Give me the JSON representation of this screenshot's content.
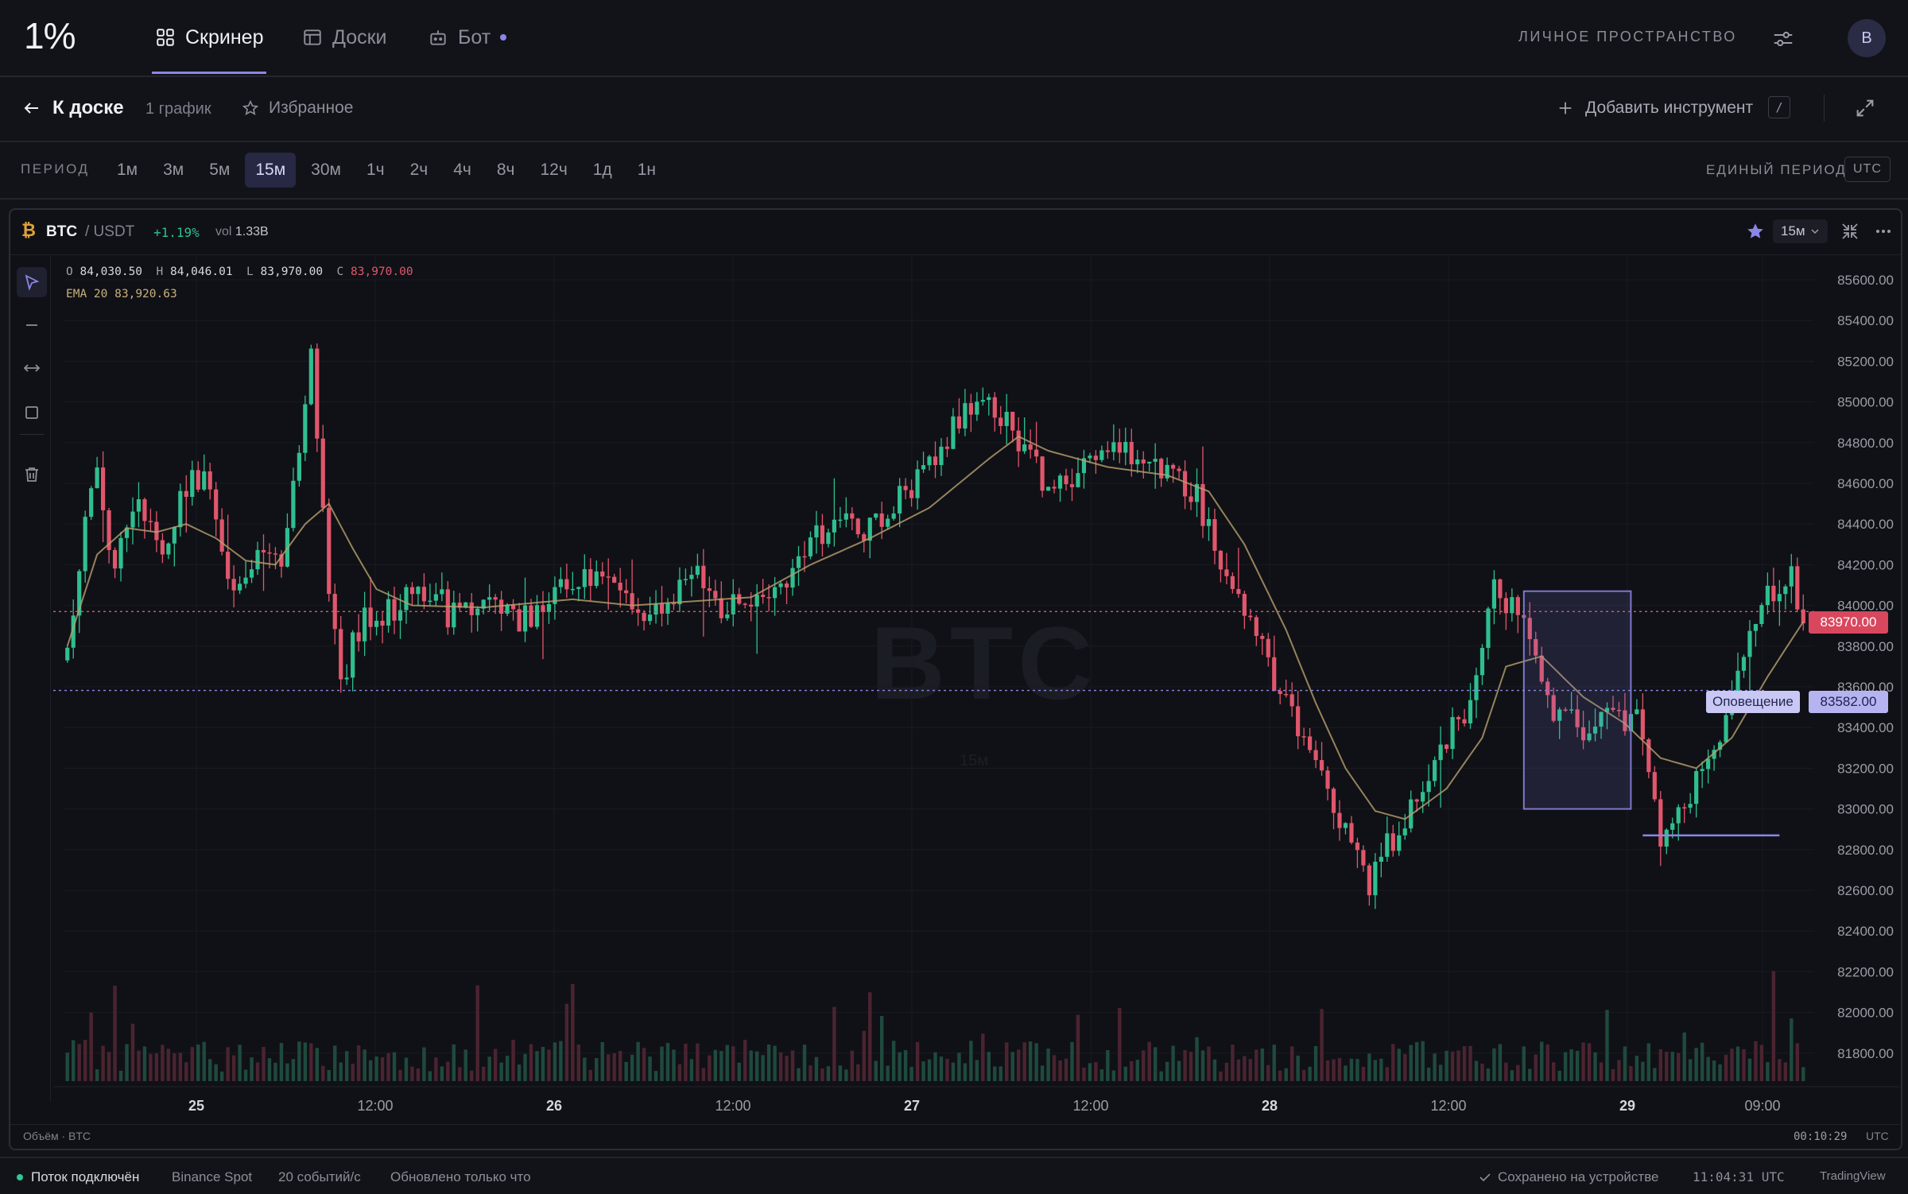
{
  "app": {
    "logo": "1%",
    "nav": [
      {
        "label": "Скринер",
        "icon": "grid-icon",
        "active": true
      },
      {
        "label": "Доски",
        "icon": "board-icon"
      },
      {
        "label": "Бот",
        "icon": "bot-icon"
      }
    ],
    "workspace_label": "ЛИЧНОЕ ПРОСТРАНСТВО",
    "avatar_initial": "B",
    "accent": "#8b86e6"
  },
  "subbar": {
    "back_label": "К доске",
    "chart_count": "1 график",
    "favorites_label": "Избранное",
    "add_instrument_label": "Добавить инструмент",
    "shortcut_key": "/"
  },
  "periods": {
    "label": "ПЕРИОД",
    "items": [
      "1м",
      "3м",
      "5м",
      "15м",
      "30м",
      "1ч",
      "2ч",
      "4ч",
      "8ч",
      "12ч",
      "1д",
      "1н"
    ],
    "active": "15м",
    "unified_label": "ЕДИНЫЙ ПЕРИОД",
    "timezone": "UTC"
  },
  "chart_panel": {
    "symbol": "BTC",
    "quote": "/ USDT",
    "change": "+1.19%",
    "vol_label": "vol",
    "vol_value": "1.33B",
    "timeframe": "15м",
    "ohlc": {
      "o_label": "O",
      "o": "84,030.50",
      "h_label": "H",
      "h": "84,046.01",
      "l_label": "L",
      "l": "83,970.00",
      "c_label": "C",
      "c": "83,970.00"
    },
    "ema_label": "EMA 20",
    "ema_value": "83,920.63",
    "watermark": "BTC",
    "watermark_sub": "15м",
    "last_price": "83970.00",
    "alert_label": "Оповещение",
    "alert_price": "83582.00",
    "volume_label": "Объём · BTC",
    "timer": "00:10:29",
    "timezone": "UTC",
    "colors": {
      "up": "#2fbf8f",
      "down": "#e0566c",
      "ema": "#b8a06e",
      "alert": "#8b86e6"
    }
  },
  "chart_data": {
    "type": "candlestick",
    "y_ticks": [
      "85600.00",
      "85400.00",
      "85200.00",
      "85000.00",
      "84800.00",
      "84600.00",
      "84400.00",
      "84200.00",
      "84000.00",
      "83800.00",
      "83600.00",
      "83400.00",
      "83200.00",
      "83000.00",
      "82800.00",
      "82600.00",
      "82400.00",
      "82200.00",
      "82000.00",
      "81800.00"
    ],
    "x_ticks": [
      {
        "label": "25",
        "bold": true
      },
      {
        "label": "12:00"
      },
      {
        "label": "26",
        "bold": true
      },
      {
        "label": "12:00"
      },
      {
        "label": "27",
        "bold": true
      },
      {
        "label": "12:00"
      },
      {
        "label": "28",
        "bold": true
      },
      {
        "label": "12:00"
      },
      {
        "label": "29",
        "bold": true
      },
      {
        "label": "09:00"
      }
    ],
    "ylim": [
      81700,
      85700
    ],
    "price_path": [
      [
        0,
        83730
      ],
      [
        3,
        84470
      ],
      [
        5,
        84700
      ],
      [
        8,
        84170
      ],
      [
        12,
        84500
      ],
      [
        16,
        84200
      ],
      [
        20,
        84580
      ],
      [
        24,
        84650
      ],
      [
        28,
        84030
      ],
      [
        32,
        84320
      ],
      [
        36,
        84250
      ],
      [
        39,
        84780
      ],
      [
        41,
        85200
      ],
      [
        44,
        84050
      ],
      [
        46,
        83650
      ],
      [
        50,
        83950
      ],
      [
        55,
        84000
      ],
      [
        60,
        84100
      ],
      [
        65,
        83940
      ],
      [
        70,
        84020
      ],
      [
        75,
        83950
      ],
      [
        80,
        83930
      ],
      [
        85,
        84150
      ],
      [
        90,
        84110
      ],
      [
        95,
        83970
      ],
      [
        100,
        84020
      ],
      [
        105,
        84150
      ],
      [
        110,
        83980
      ],
      [
        115,
        84000
      ],
      [
        120,
        84110
      ],
      [
        125,
        84320
      ],
      [
        130,
        84400
      ],
      [
        135,
        84380
      ],
      [
        140,
        84550
      ],
      [
        145,
        84680
      ],
      [
        150,
        84920
      ],
      [
        155,
        85020
      ],
      [
        160,
        84810
      ],
      [
        165,
        84550
      ],
      [
        170,
        84620
      ],
      [
        175,
        84780
      ],
      [
        180,
        84700
      ],
      [
        185,
        84650
      ],
      [
        190,
        84550
      ],
      [
        195,
        84100
      ],
      [
        200,
        83820
      ],
      [
        205,
        83550
      ],
      [
        210,
        83180
      ],
      [
        215,
        82900
      ],
      [
        219,
        82650
      ],
      [
        225,
        82950
      ],
      [
        230,
        83250
      ],
      [
        235,
        83500
      ],
      [
        240,
        84050
      ],
      [
        245,
        83950
      ],
      [
        250,
        83500
      ],
      [
        255,
        83350
      ],
      [
        260,
        83450
      ],
      [
        265,
        83420
      ],
      [
        268,
        82850
      ],
      [
        272,
        82970
      ],
      [
        275,
        83200
      ],
      [
        280,
        83500
      ],
      [
        285,
        84000
      ],
      [
        290,
        84120
      ],
      [
        292,
        83970
      ]
    ],
    "ema_path": [
      [
        0,
        83800
      ],
      [
        5,
        84250
      ],
      [
        10,
        84380
      ],
      [
        15,
        84360
      ],
      [
        20,
        84400
      ],
      [
        25,
        84330
      ],
      [
        30,
        84220
      ],
      [
        35,
        84200
      ],
      [
        40,
        84400
      ],
      [
        44,
        84500
      ],
      [
        48,
        84280
      ],
      [
        52,
        84080
      ],
      [
        58,
        84000
      ],
      [
        70,
        83990
      ],
      [
        85,
        84030
      ],
      [
        95,
        84000
      ],
      [
        105,
        84020
      ],
      [
        115,
        84040
      ],
      [
        125,
        84200
      ],
      [
        135,
        84330
      ],
      [
        145,
        84480
      ],
      [
        155,
        84720
      ],
      [
        160,
        84830
      ],
      [
        165,
        84760
      ],
      [
        175,
        84680
      ],
      [
        185,
        84640
      ],
      [
        192,
        84560
      ],
      [
        198,
        84300
      ],
      [
        205,
        83880
      ],
      [
        210,
        83520
      ],
      [
        215,
        83200
      ],
      [
        220,
        82990
      ],
      [
        225,
        82950
      ],
      [
        232,
        83100
      ],
      [
        238,
        83350
      ],
      [
        242,
        83700
      ],
      [
        248,
        83750
      ],
      [
        255,
        83550
      ],
      [
        262,
        83420
      ],
      [
        268,
        83250
      ],
      [
        274,
        83200
      ],
      [
        280,
        83350
      ],
      [
        286,
        83650
      ],
      [
        292,
        83920
      ]
    ],
    "selection_box": {
      "x": [
        245,
        263
      ],
      "y": [
        83000,
        84070
      ]
    },
    "support_line": {
      "x": [
        265,
        288
      ],
      "y": 82870
    },
    "last_price": 83970,
    "alert_level": 83582
  },
  "status": {
    "connection": "Поток подключён",
    "exchange": "Binance Spot",
    "rate": "20 событий/с",
    "updated": "Обновлено только что",
    "saved": "Сохранено на устройстве",
    "clock": "11:04:31 UTC",
    "attribution": "TradingView"
  }
}
